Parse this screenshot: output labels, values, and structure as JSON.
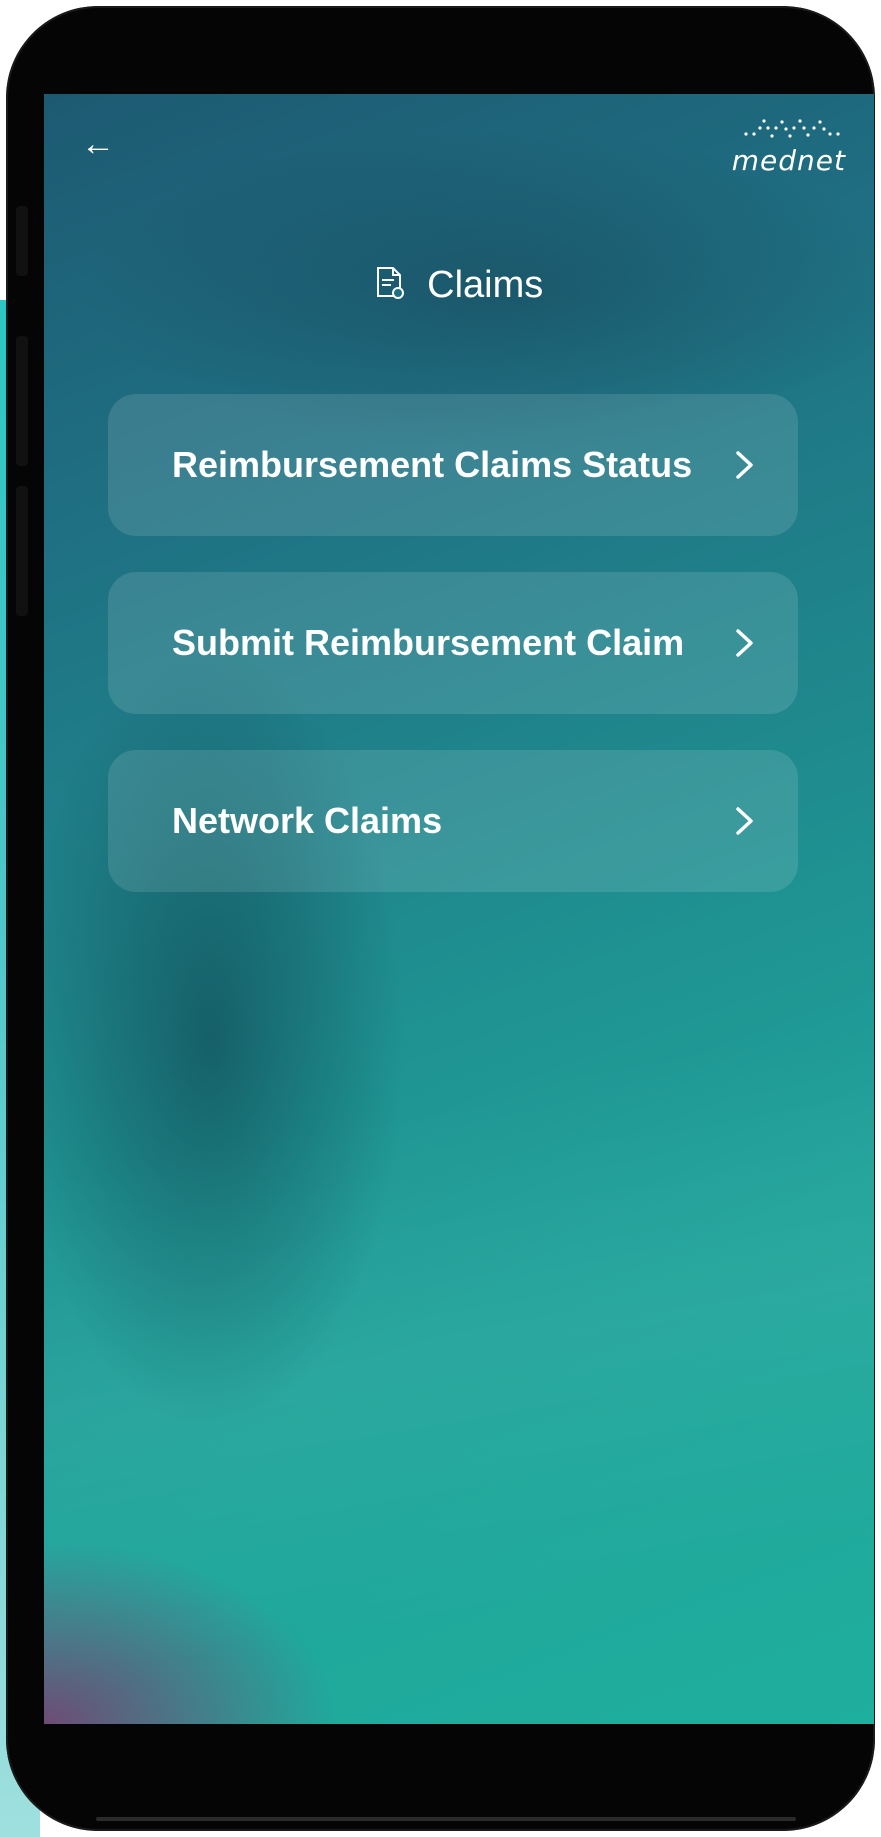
{
  "header": {
    "back_icon": "arrow-left-icon",
    "logo_text": "mednet"
  },
  "page": {
    "title": "Claims",
    "title_icon": "document-icon"
  },
  "menu": {
    "items": [
      {
        "label": "Reimbursement Claims Status",
        "icon": "chevron-right-icon"
      },
      {
        "label": "Submit Reimbursement Claim",
        "icon": "chevron-right-icon"
      },
      {
        "label": "Network Claims",
        "icon": "chevron-right-icon"
      }
    ]
  },
  "colors": {
    "gradient_top": "#1d5a72",
    "gradient_bottom": "#1faf9e",
    "accent_purple": "#7c3c6e",
    "text": "#ffffff"
  }
}
